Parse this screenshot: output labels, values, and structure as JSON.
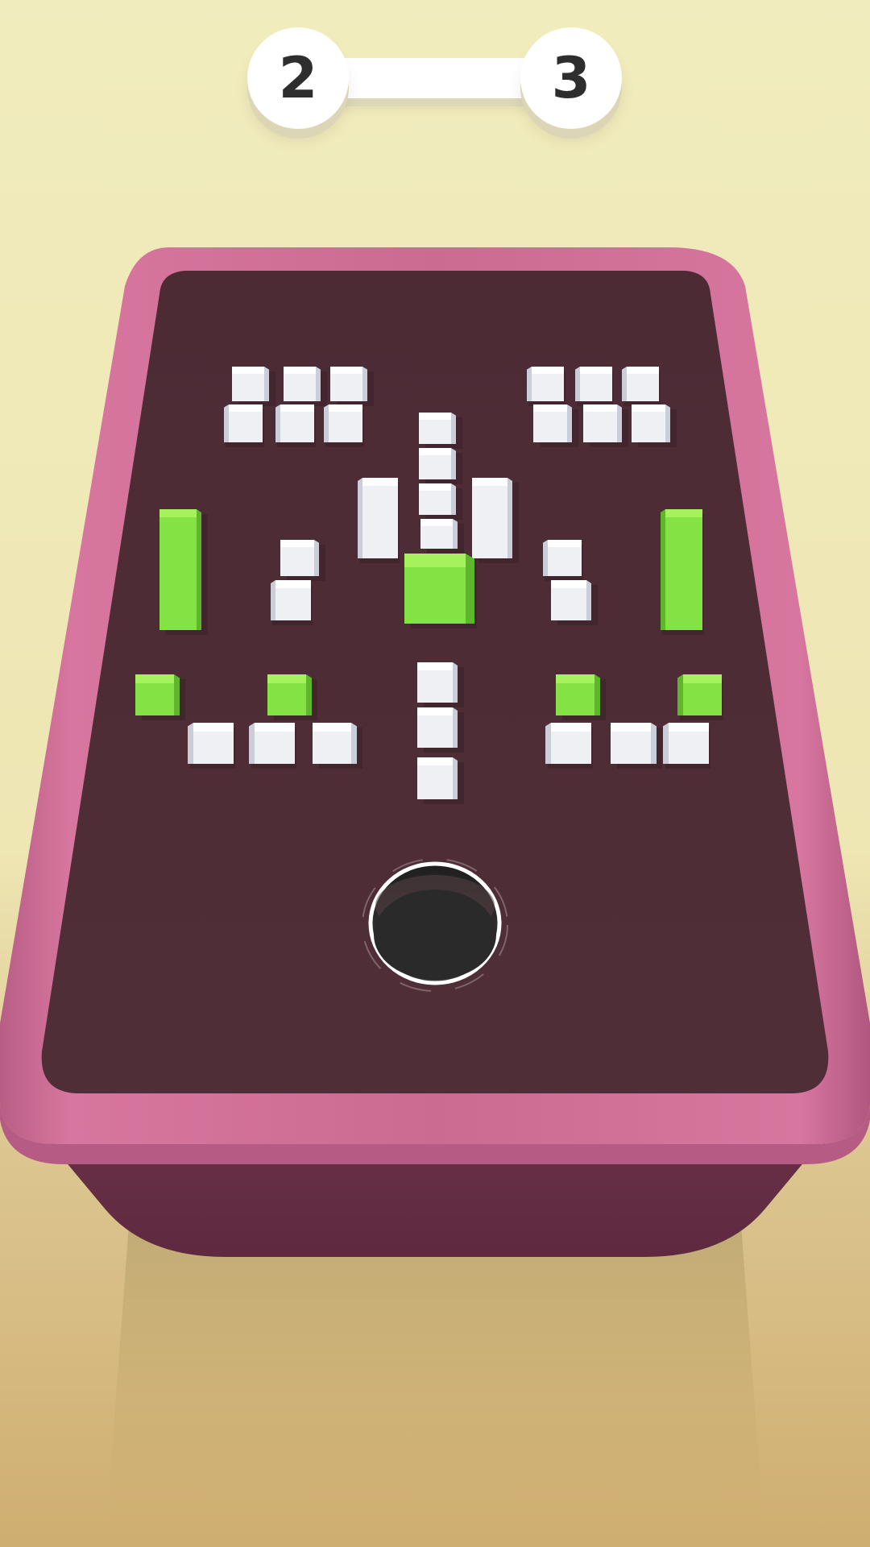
{
  "level": {
    "current": "2",
    "next": "3"
  },
  "colors": {
    "background_top": "#f1ecbd",
    "tray_rim": "#cc6b92",
    "tray_floor": "#4f2d37",
    "tray_side": "#652e46",
    "target_block": "#8ee84e",
    "obstacle_block": "#f2f4f7",
    "hole": "#2b2b2b"
  },
  "icons": {
    "hole": "black-hole-icon"
  }
}
